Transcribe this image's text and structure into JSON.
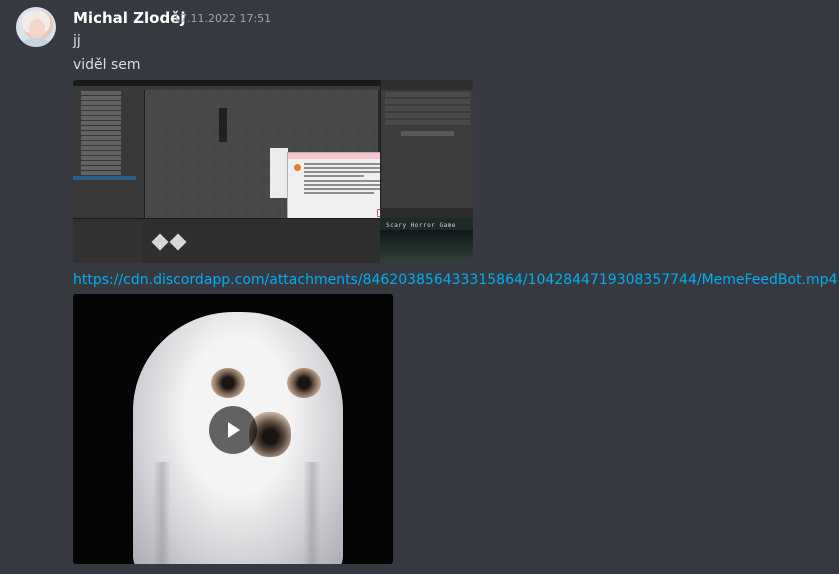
{
  "message": {
    "author": "Michal Zloděj",
    "timestamp": "17.11.2022 17:51",
    "lines": [
      "jj",
      "viděl sem"
    ]
  },
  "attachments": {
    "image": {
      "game_title": "Scary Horror Game"
    },
    "link": "https://cdn.discordapp.com/attachments/846203856433315864/1042844719308357744/MemeFeedBot.mp4",
    "video": {
      "play_icon": "play-icon"
    }
  },
  "colors": {
    "background": "#36393f",
    "author": "#ffffff",
    "text": "#dcddde",
    "timestamp": "#a3a6aa",
    "link": "#00aff4"
  }
}
